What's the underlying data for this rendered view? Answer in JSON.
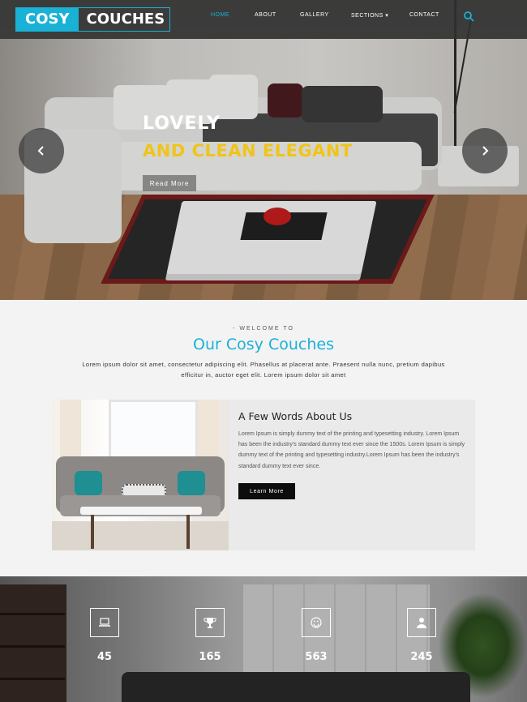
{
  "header": {
    "logo_part1": "COSY",
    "logo_part2": "COUCHES",
    "nav": [
      {
        "label": "HOME",
        "active": true
      },
      {
        "label": "ABOUT",
        "active": false
      },
      {
        "label": "GALLERY",
        "active": false
      },
      {
        "label": "SECTIONS ▾",
        "active": false
      },
      {
        "label": "CONTACT",
        "active": false
      }
    ],
    "search_icon": "search-icon"
  },
  "hero": {
    "line1": "LOVELY",
    "line2": "AND CLEAN ELEGANT",
    "button": "Read More",
    "prev_icon": "chevron-left-icon",
    "next_icon": "chevron-right-icon"
  },
  "welcome": {
    "label": "- WELCOME TO",
    "title": "Our Cosy Couches",
    "text": "Lorem ipsum dolor sit amet, consectetur adipiscing elit. Phasellus at placerat ante. Praesent nulla nunc, pretium dapibus efficitur in, auctor eget elit. Lorem ipsum dolor sit amet"
  },
  "about": {
    "title": "A Few Words About Us",
    "text": "Lorem Ipsum is simply dummy text of the printing and typesetting industry. Lorem Ipsum has been the industry's standard dummy text ever since the 1500s. Lorem Ipsum is simply dummy text of the printing and typesetting industry.Lorem Ipsum has been the industry's standard dummy text ever since.",
    "button": "Learn More"
  },
  "stats": [
    {
      "icon": "laptop-icon",
      "value": "45",
      "label": ""
    },
    {
      "icon": "trophy-icon",
      "value": "165",
      "label": ""
    },
    {
      "icon": "smile-icon",
      "value": "563",
      "label": ""
    },
    {
      "icon": "user-icon",
      "value": "245",
      "label": ""
    }
  ],
  "colors": {
    "accent": "#1ab1d6",
    "highlight": "#f0c419",
    "header_bg": "#303030"
  }
}
